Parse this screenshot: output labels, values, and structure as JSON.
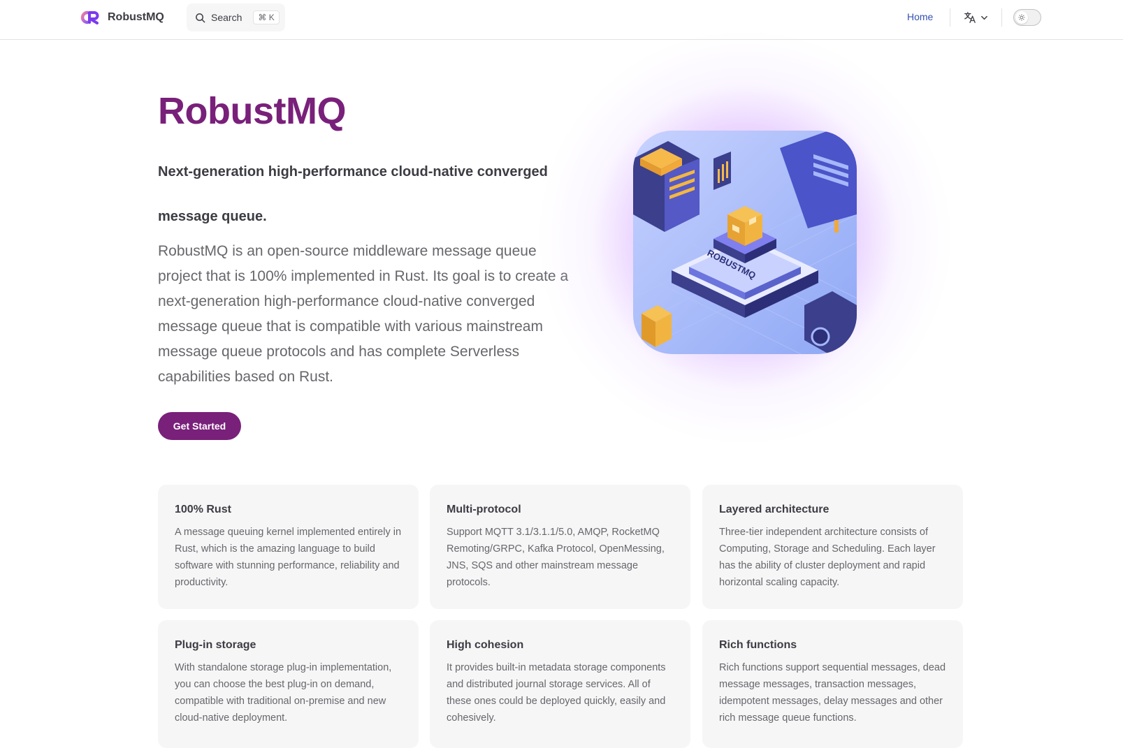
{
  "nav": {
    "brand": "RobustMQ",
    "search_label": "Search",
    "search_shortcut": "⌘ K",
    "home": "Home",
    "lang_icon": "translate-icon",
    "theme_icon": "sun-icon"
  },
  "hero": {
    "title": "RobustMQ",
    "tagline": "Next-generation high-performance cloud-native converged message queue.",
    "description": "RobustMQ is an open-source middleware message queue project that is 100% implemented in Rust. Its goal is to create a next-generation high-performance cloud-native converged message queue that is compatible with various mainstream message queue protocols and has complete Serverless capabilities based on Rust.",
    "cta": "Get Started",
    "image_label": "ROBUSTMQ"
  },
  "features": [
    {
      "title": "100% Rust",
      "text": "A message queuing kernel implemented entirely in Rust, which is the amazing language to build software with stunning performance, reliability and productivity."
    },
    {
      "title": "Multi-protocol",
      "text": "Support MQTT 3.1/3.1.1/5.0, AMQP, RocketMQ Remoting/GRPC, Kafka Protocol, OpenMessing, JNS, SQS and other mainstream message protocols."
    },
    {
      "title": "Layered architecture",
      "text": "Three-tier independent architecture consists of Computing, Storage and Scheduling. Each layer has the ability of cluster deployment and rapid horizontal scaling capacity."
    },
    {
      "title": "Plug-in storage",
      "text": "With standalone storage plug-in implementation, you can choose the best plug-in on demand, compatible with traditional on-premise and new cloud-native deployment."
    },
    {
      "title": "High cohesion",
      "text": "It provides built-in metadata storage components and distributed journal storage services. All of these ones could be deployed quickly, easily and cohesively."
    },
    {
      "title": "Rich functions",
      "text": "Rich functions support sequential messages, dead message messages, transaction messages, idempotent messages, delay messages and other rich message queue functions."
    }
  ],
  "colors": {
    "brand": "#79207a",
    "link": "#3451b2",
    "card_bg": "#f6f6f7"
  }
}
